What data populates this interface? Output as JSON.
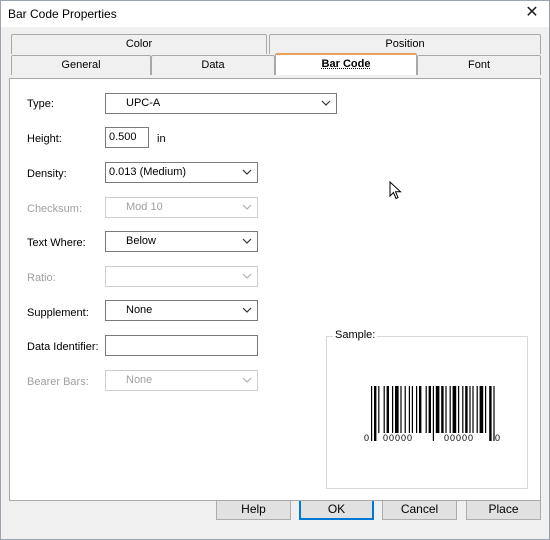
{
  "window": {
    "title": "Bar Code Properties",
    "close_glyph": "✕"
  },
  "tabs_back": [
    {
      "label": "Color"
    },
    {
      "label": "Position"
    }
  ],
  "tabs_front": [
    {
      "label": "General"
    },
    {
      "label": "Data"
    },
    {
      "label": "Bar Code"
    },
    {
      "label": "Font"
    }
  ],
  "active_tab": "Bar Code",
  "form": {
    "type_label": "Type:",
    "type_value": "UPC-A",
    "height_label": "Height:",
    "height_value": "0.500",
    "height_unit": "in",
    "density_label": "Density:",
    "density_value": "0.013 (Medium)",
    "checksum_label": "Checksum:",
    "checksum_value": "Mod 10",
    "text_where_label": "Text Where:",
    "text_where_value": "Below",
    "ratio_label": "Ratio:",
    "ratio_value": "",
    "supplement_label": "Supplement:",
    "supplement_value": "None",
    "data_identifier_label": "Data Identifier:",
    "data_identifier_value": "",
    "bearer_bars_label": "Bearer Bars:",
    "bearer_bars_value": "None"
  },
  "sample": {
    "label": "Sample:",
    "left_digit": "0",
    "left_group": "00000",
    "right_group": "00000",
    "right_digit": "0"
  },
  "buttons": {
    "help": "Help",
    "ok": "OK",
    "cancel": "Cancel",
    "place": "Place"
  },
  "colors": {
    "active_tab_accent": "#e8a15a",
    "default_button_border": "#0078d7",
    "disabled_text": "#a0a0a0"
  }
}
